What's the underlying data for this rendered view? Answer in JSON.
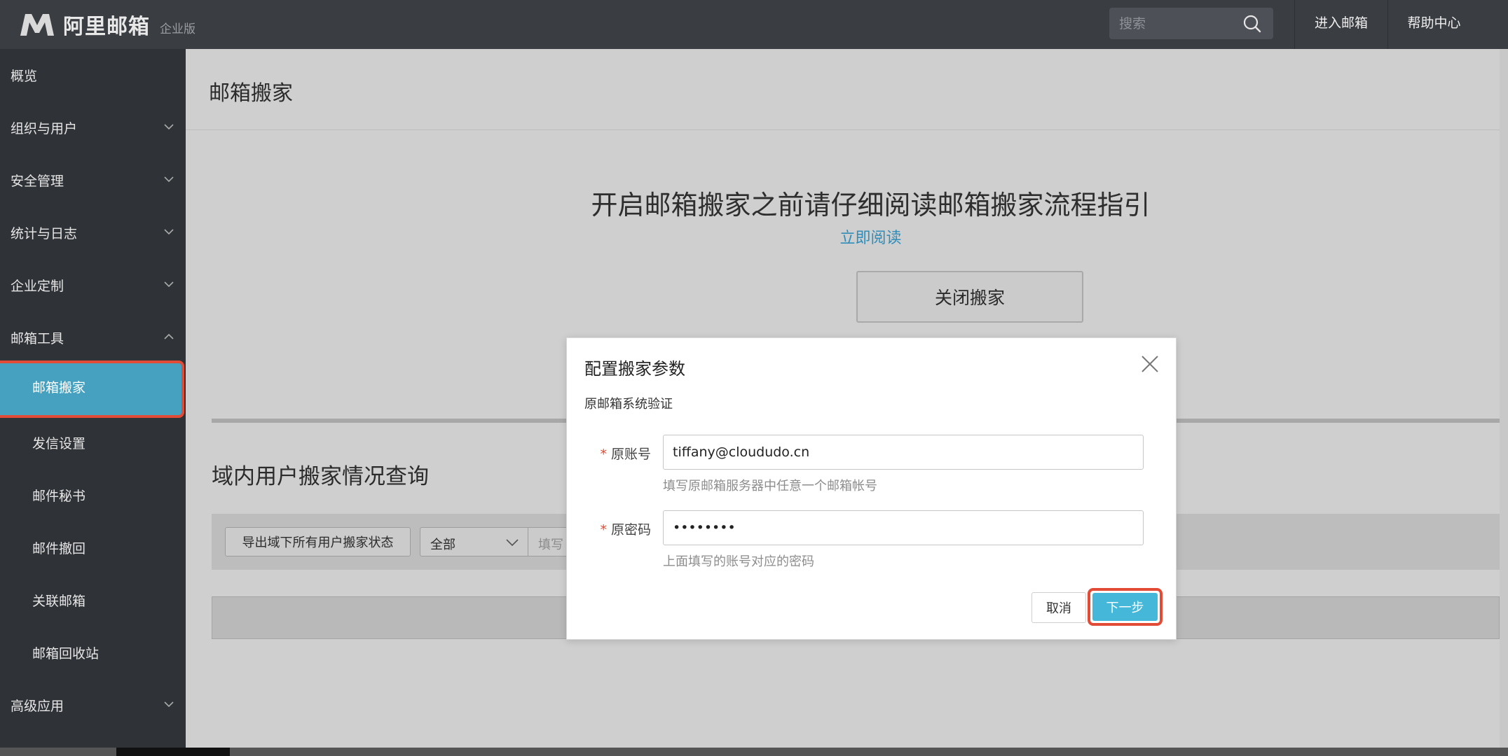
{
  "header": {
    "logo_text": "阿里邮箱",
    "logo_edition": "企业版",
    "search_placeholder": "搜索",
    "enter_mailbox": "进入邮箱",
    "help_center": "帮助中心"
  },
  "sidebar": {
    "items": [
      {
        "label": "概览",
        "expandable": false
      },
      {
        "label": "组织与用户",
        "expandable": true,
        "expanded": false
      },
      {
        "label": "安全管理",
        "expandable": true,
        "expanded": false
      },
      {
        "label": "统计与日志",
        "expandable": true,
        "expanded": false
      },
      {
        "label": "企业定制",
        "expandable": true,
        "expanded": false
      },
      {
        "label": "邮箱工具",
        "expandable": true,
        "expanded": true
      },
      {
        "label": "邮箱搬家",
        "sub": true,
        "active": true
      },
      {
        "label": "发信设置",
        "sub": true
      },
      {
        "label": "邮件秘书",
        "sub": true
      },
      {
        "label": "邮件撤回",
        "sub": true
      },
      {
        "label": "关联邮箱",
        "sub": true
      },
      {
        "label": "邮箱回收站",
        "sub": true
      },
      {
        "label": "高级应用",
        "expandable": true,
        "expanded": false
      }
    ],
    "active_color": "#45a1bf",
    "highlight_color": "#e24b35"
  },
  "main": {
    "page_title": "邮箱搬家",
    "guide_title": "开启邮箱搬家之前请仔细阅读邮箱搬家流程指引",
    "read_now": "立即阅读",
    "close_migration": "关闭搬家",
    "section_title": "域内用户搬家情况查询",
    "export_button": "导出域下所有用户搬家状态",
    "status_select": "全部",
    "filter_placeholder": "填写"
  },
  "modal": {
    "title": "配置搬家参数",
    "subtitle": "原邮箱系统验证",
    "required_mark": "*",
    "account_label": "原账号",
    "account_value": "tiffany@cloududo.cn",
    "account_hint": "填写原邮箱服务器中任意一个邮箱帐号",
    "password_label": "原密码",
    "password_value": "••••••••",
    "password_hint": "上面填写的账号对应的密码",
    "cancel": "取消",
    "next": "下一步",
    "next_color": "#45b7d8"
  }
}
